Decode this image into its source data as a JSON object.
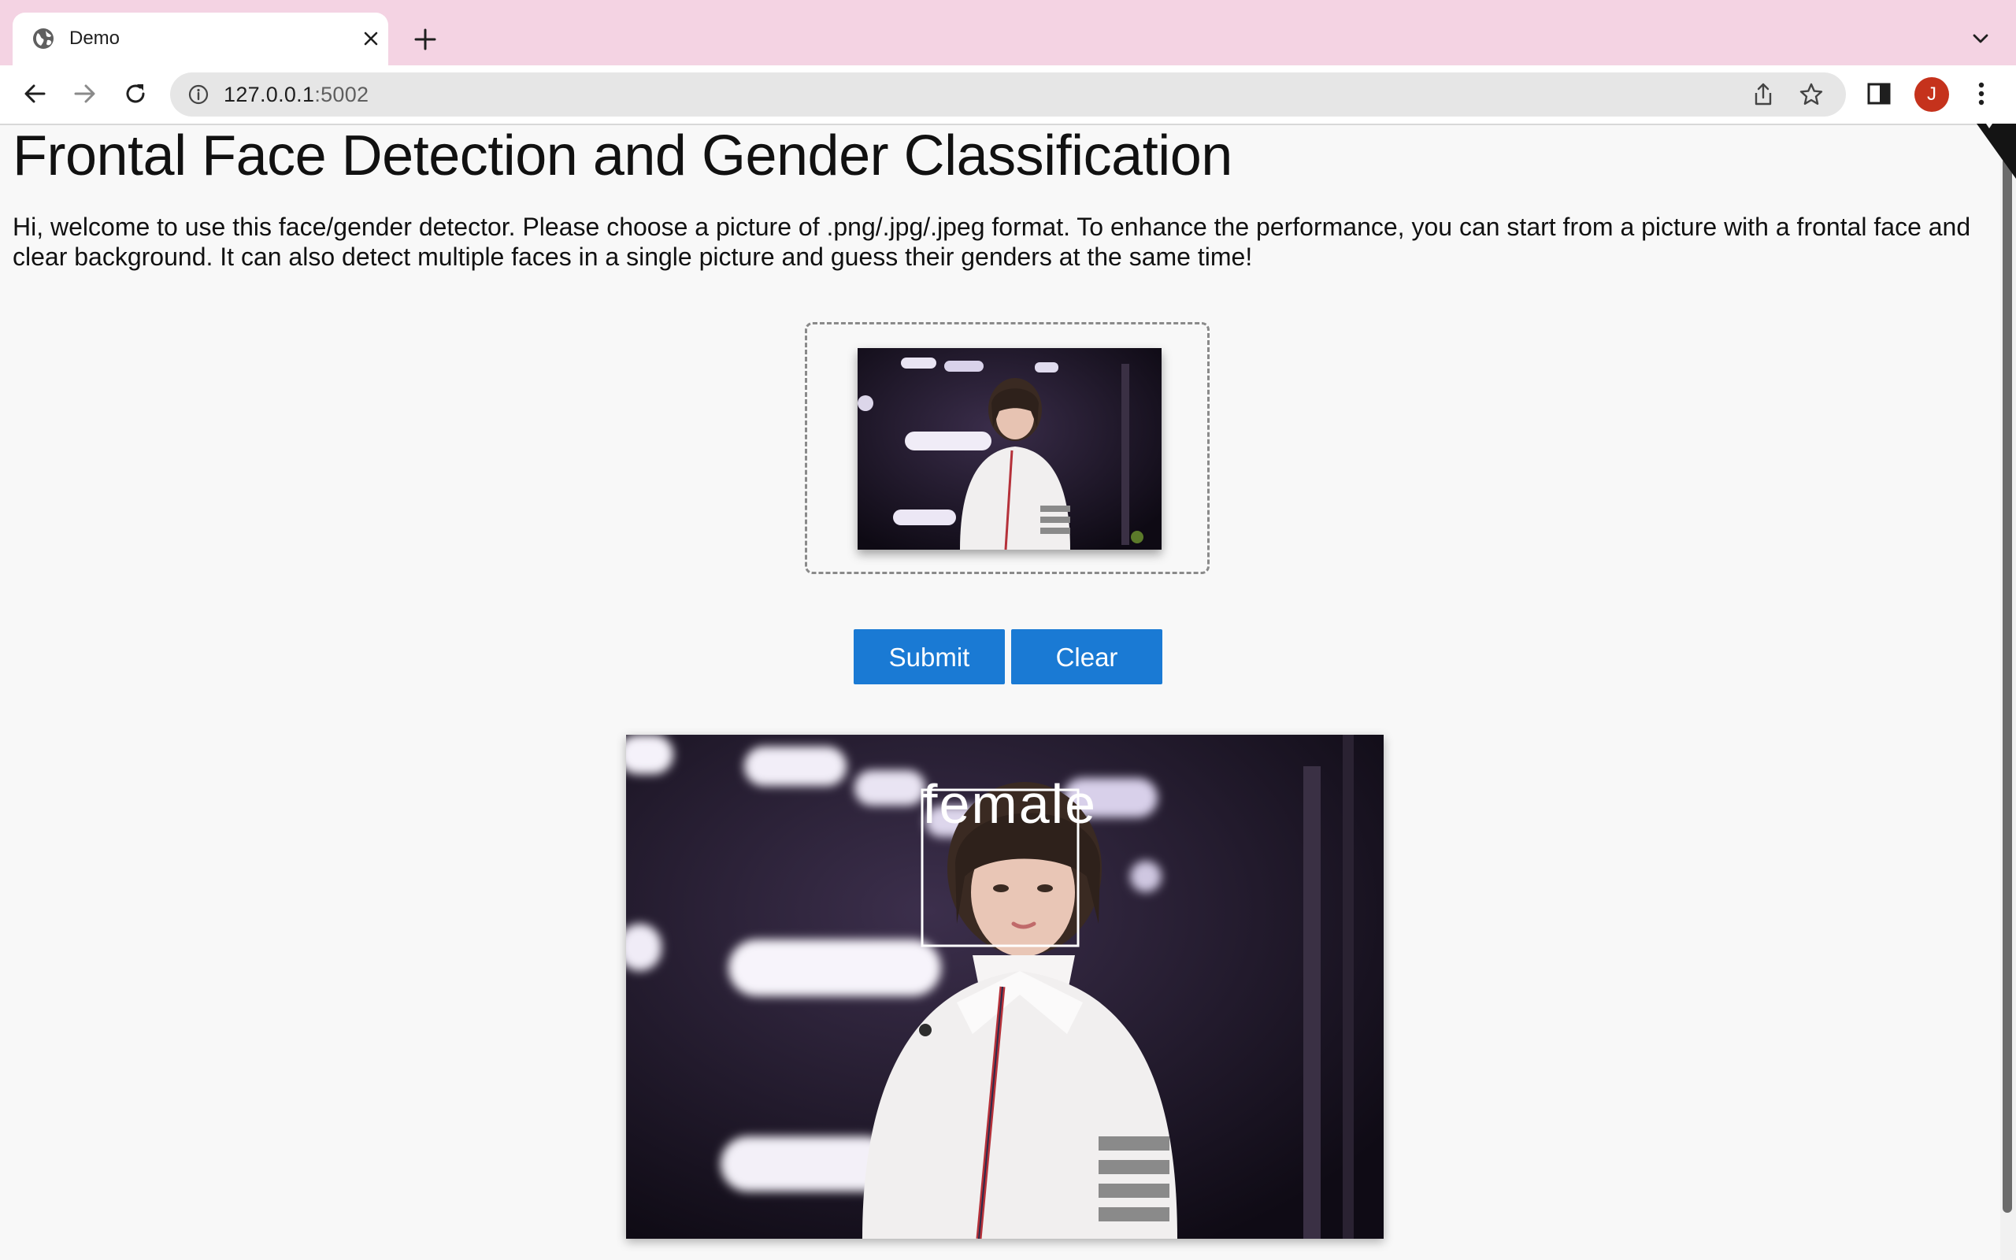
{
  "browser": {
    "tab": {
      "title": "Demo",
      "icon": "globe-icon"
    },
    "url": {
      "host": "127.0.0.1",
      "port": ":5002"
    },
    "profile_initial": "J"
  },
  "page": {
    "title": "Frontal Face Detection and Gender Classification",
    "intro": "Hi, welcome to use this face/gender detector. Please choose a picture of .png/.jpg/.jpeg format. To enhance the performance, you can start from a picture with a frontal face and clear background. It can also detect multiple faces in a single picture and guess their genders at the same time!",
    "buttons": {
      "submit": "Submit",
      "clear": "Clear"
    },
    "result": {
      "label": "female"
    }
  },
  "colors": {
    "tabstrip": "#f4d3e3",
    "button": "#1a7ad4",
    "avatar": "#c5321c"
  }
}
